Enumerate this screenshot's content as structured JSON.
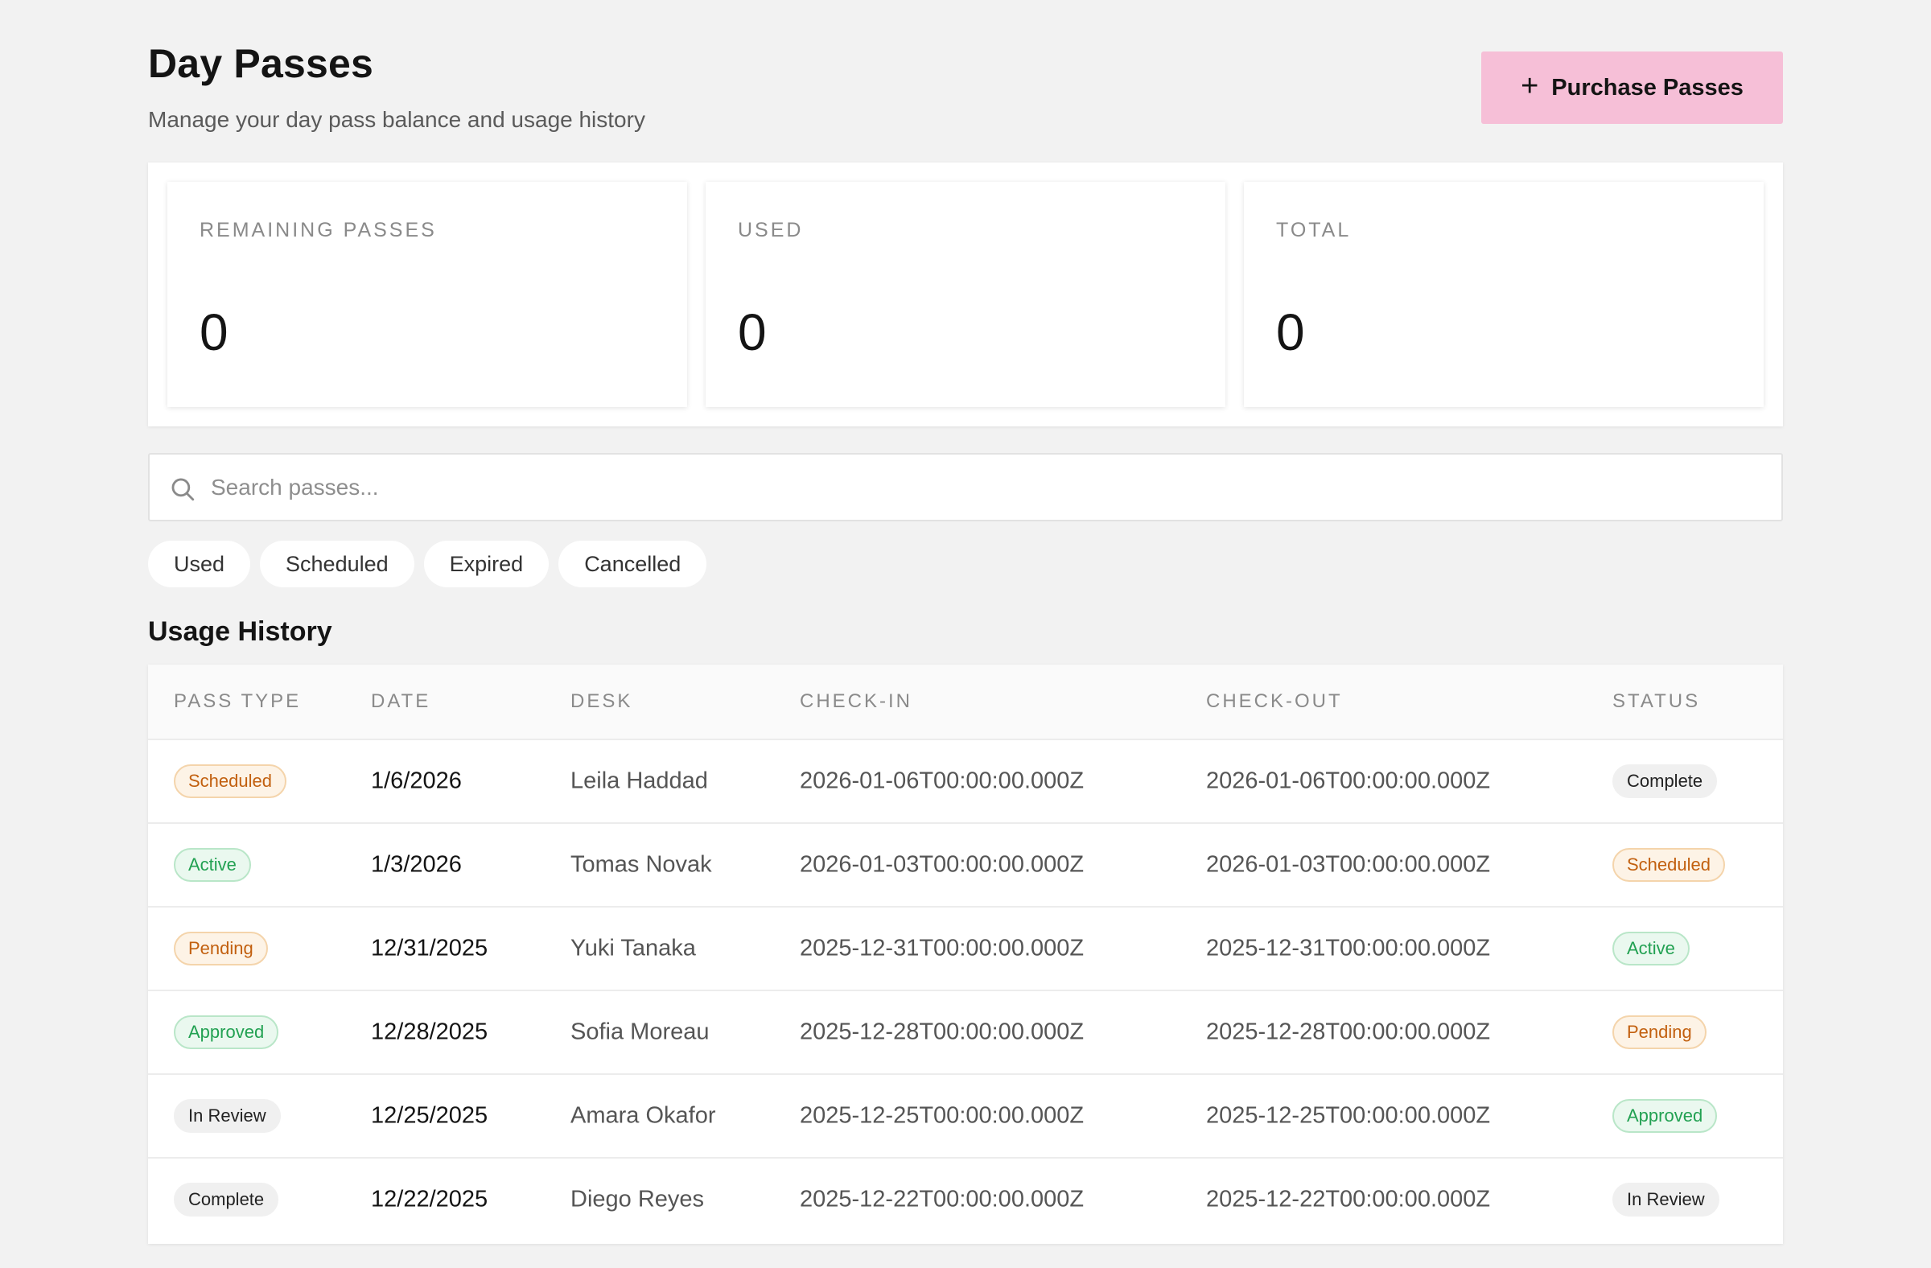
{
  "header": {
    "title": "Day Passes",
    "subtitle": "Manage your day pass balance and usage history",
    "purchase_label": "Purchase Passes",
    "purchase_icon": "plus-icon"
  },
  "stats": [
    {
      "label": "REMAINING PASSES",
      "value": "0"
    },
    {
      "label": "USED",
      "value": "0"
    },
    {
      "label": "TOTAL",
      "value": "0"
    }
  ],
  "search": {
    "placeholder": "Search passes...",
    "value": "",
    "icon": "search-icon"
  },
  "filters": [
    "Used",
    "Scheduled",
    "Expired",
    "Cancelled"
  ],
  "usage": {
    "title": "Usage History",
    "columns": [
      "PASS TYPE",
      "DATE",
      "DESK",
      "CHECK-IN",
      "CHECK-OUT",
      "STATUS"
    ],
    "rows": [
      {
        "pass_type": "Scheduled",
        "date": "1/6/2026",
        "desk": "Leila Haddad",
        "check_in": "2026-01-06T00:00:00.000Z",
        "check_out": "2026-01-06T00:00:00.000Z",
        "status": "Complete"
      },
      {
        "pass_type": "Active",
        "date": "1/3/2026",
        "desk": "Tomas Novak",
        "check_in": "2026-01-03T00:00:00.000Z",
        "check_out": "2026-01-03T00:00:00.000Z",
        "status": "Scheduled"
      },
      {
        "pass_type": "Pending",
        "date": "12/31/2025",
        "desk": "Yuki Tanaka",
        "check_in": "2025-12-31T00:00:00.000Z",
        "check_out": "2025-12-31T00:00:00.000Z",
        "status": "Active"
      },
      {
        "pass_type": "Approved",
        "date": "12/28/2025",
        "desk": "Sofia Moreau",
        "check_in": "2025-12-28T00:00:00.000Z",
        "check_out": "2025-12-28T00:00:00.000Z",
        "status": "Pending"
      },
      {
        "pass_type": "In Review",
        "date": "12/25/2025",
        "desk": "Amara Okafor",
        "check_in": "2025-12-25T00:00:00.000Z",
        "check_out": "2025-12-25T00:00:00.000Z",
        "status": "Approved"
      },
      {
        "pass_type": "Complete",
        "date": "12/22/2025",
        "desk": "Diego Reyes",
        "check_in": "2025-12-22T00:00:00.000Z",
        "check_out": "2025-12-22T00:00:00.000Z",
        "status": "In Review"
      }
    ]
  },
  "colors": {
    "accent": "#f6bfd7",
    "background": "#f2f2f2",
    "badge_orange": "#c2600f",
    "badge_green": "#22a152",
    "badge_grey": "#222222"
  }
}
